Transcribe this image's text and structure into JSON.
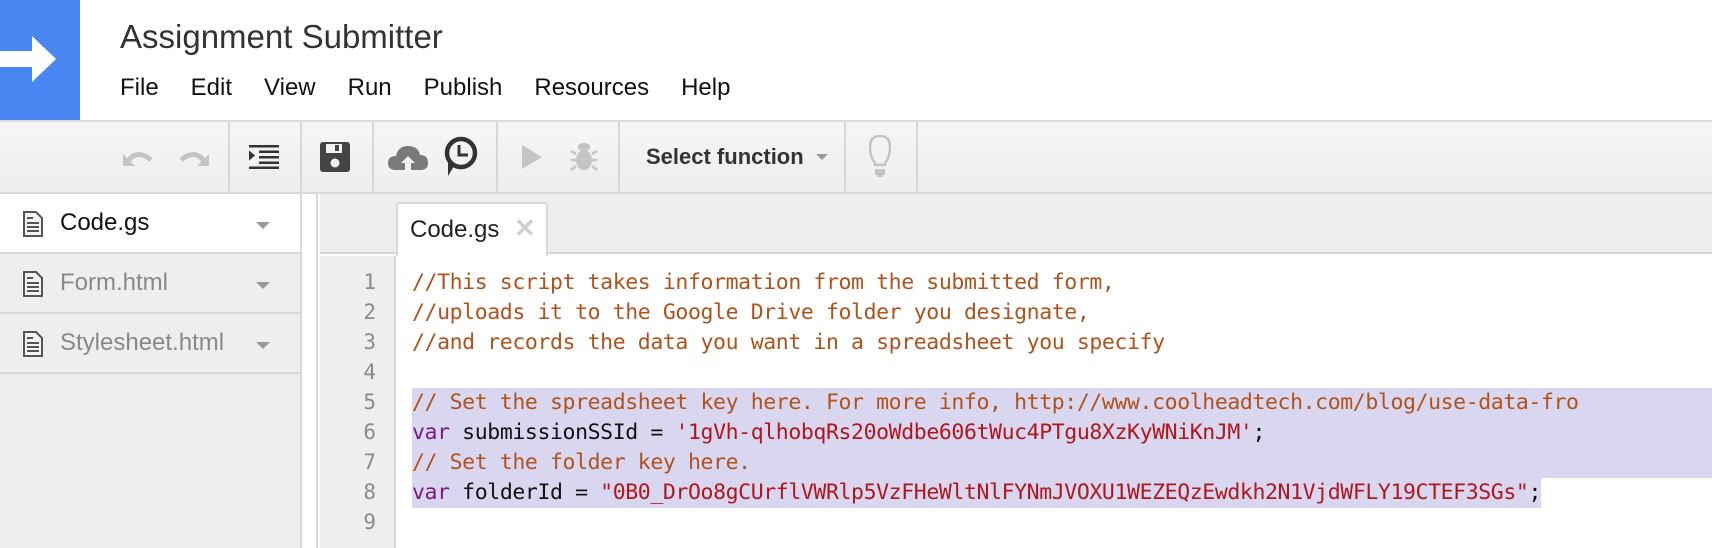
{
  "app": {
    "title": "Assignment Submitter",
    "accent_color": "#4887f1"
  },
  "menu": {
    "items": [
      {
        "label": "File"
      },
      {
        "label": "Edit"
      },
      {
        "label": "View"
      },
      {
        "label": "Run"
      },
      {
        "label": "Publish"
      },
      {
        "label": "Resources"
      },
      {
        "label": "Help"
      }
    ]
  },
  "toolbar": {
    "undo_icon": "undo-icon",
    "redo_icon": "redo-icon",
    "indent_icon": "indent-icon",
    "save_icon": "save-icon",
    "deploy_icon": "cloud-upload-icon",
    "triggers_icon": "clock-icon",
    "run_icon": "play-icon",
    "debug_icon": "bug-icon",
    "select_function_label": "Select function",
    "tips_icon": "lightbulb-icon"
  },
  "sidebar": {
    "files": [
      {
        "name": "Code.gs",
        "active": true
      },
      {
        "name": "Form.html",
        "active": false
      },
      {
        "name": "Stylesheet.html",
        "active": false
      }
    ]
  },
  "editor": {
    "tab": {
      "label": "Code.gs",
      "close_glyph": "✕"
    },
    "line_numbers": [
      "1",
      "2",
      "3",
      "4",
      "5",
      "6",
      "7",
      "8",
      "9"
    ],
    "lines": [
      {
        "tokens": [
          {
            "type": "comment",
            "text": "//This script takes information from the submitted form,"
          }
        ],
        "selected": false
      },
      {
        "tokens": [
          {
            "type": "comment",
            "text": "//uploads it to the Google Drive folder you designate,"
          }
        ],
        "selected": false
      },
      {
        "tokens": [
          {
            "type": "comment",
            "text": "//and records the data you want in a spreadsheet you specify"
          }
        ],
        "selected": false
      },
      {
        "tokens": [],
        "selected": false
      },
      {
        "tokens": [
          {
            "type": "comment",
            "text": "// Set the spreadsheet key here. For more info, http://www.coolheadtech.com/blog/use-data-fro"
          }
        ],
        "selected": true
      },
      {
        "tokens": [
          {
            "type": "keyword",
            "text": "var"
          },
          {
            "type": "plain",
            "text": " submissionSSId = "
          },
          {
            "type": "string",
            "text": "'1gVh-qlhobqRs20oWdbe606tWuc4PTgu8XzKyWNiKnJM'"
          },
          {
            "type": "plain",
            "text": ";"
          }
        ],
        "selected": true
      },
      {
        "tokens": [
          {
            "type": "comment",
            "text": "// Set the folder key here."
          }
        ],
        "selected": true
      },
      {
        "tokens": [
          {
            "type": "keyword",
            "text": "var"
          },
          {
            "type": "plain",
            "text": " folderId = "
          },
          {
            "type": "string",
            "text": "\"0B0_DrOo8gCUrflVWRlp5VzFHeWltNlFYNmJVOXU1WEZEQzEwdkh2N1VjdWFLY19CTEF3SGs\""
          },
          {
            "type": "plain",
            "text": ";"
          }
        ],
        "selected": true
      },
      {
        "tokens": [],
        "selected": false
      }
    ]
  }
}
